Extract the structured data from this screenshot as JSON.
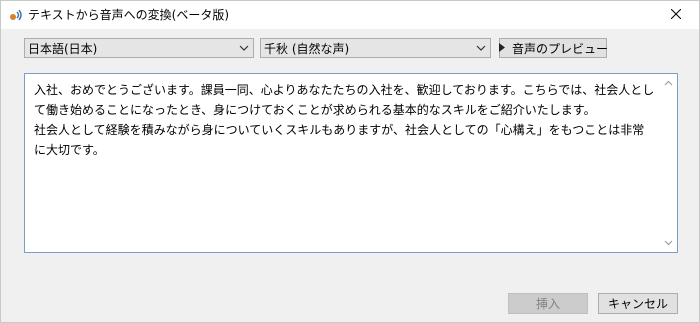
{
  "window": {
    "title": "テキストから音声への変換(ベータ版)",
    "title_icon": "speech-icon",
    "close_icon": "close-icon"
  },
  "controls": {
    "language": "日本語(日本)",
    "voice": "千秋 (自然な声)",
    "preview_label": "音声のプレビュー",
    "preview_icon": "play-icon"
  },
  "text": {
    "content": "入社、おめでとうございます。課員一同、心よりあなたたちの入社を、歓迎しております。こちらでは、社会人として働き始めることになったとき、身につけておくことが求められる基本的なスキルをご紹介いたします。\n社会人として経験を積みながら身についていくスキルもありますが、社会人としての「心構え」をもつことは非常に大切です。"
  },
  "buttons": {
    "insert": "挿入",
    "cancel": "キャンセル"
  },
  "colors": {
    "textarea_border": "#7a9ec7",
    "disabled_text": "#838383"
  }
}
